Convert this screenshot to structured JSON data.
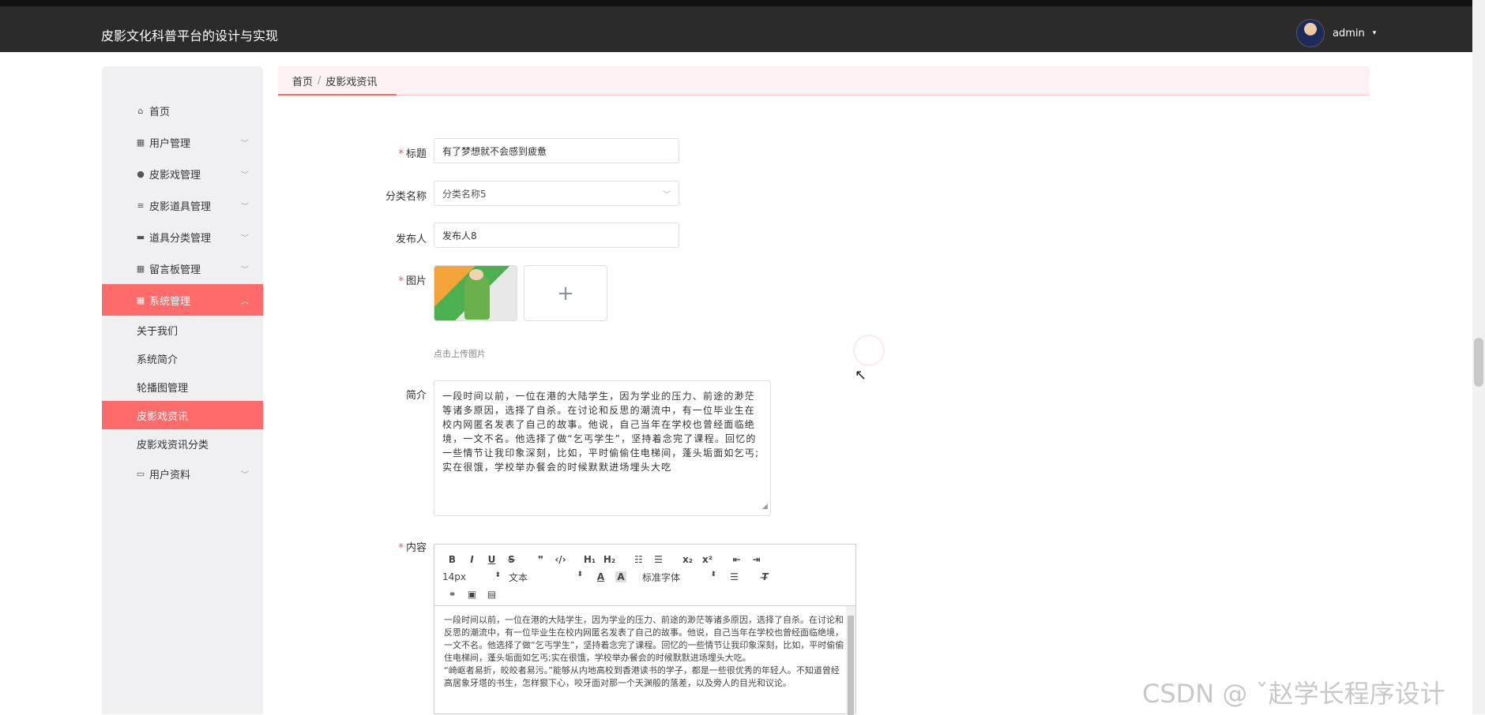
{
  "header": {
    "title": "皮影文化科普平台的设计与实现",
    "username": "admin",
    "caret": "▾"
  },
  "sidebar": {
    "items": [
      {
        "label": "首页",
        "icon": "⌂"
      },
      {
        "label": "用户管理",
        "icon": "▦"
      },
      {
        "label": "皮影戏管理",
        "icon": "●"
      },
      {
        "label": "皮影道具管理",
        "icon": "≡"
      },
      {
        "label": "道具分类管理",
        "icon": "▬"
      },
      {
        "label": "留言板管理",
        "icon": "▦"
      },
      {
        "label": "系统管理",
        "icon": "▦"
      }
    ],
    "system_sub": [
      "关于我们",
      "系统简介",
      "轮播图管理",
      "皮影戏资讯",
      "皮影戏资讯分类"
    ],
    "last_item": {
      "label": "用户资料",
      "icon": "▭"
    }
  },
  "breadcrumb": {
    "home": "首页",
    "sep": "/",
    "current": "皮影戏资讯"
  },
  "form": {
    "title_label": "标题",
    "title_value": "有了梦想就不会感到疲惫",
    "category_label": "分类名称",
    "category_value": "分类名称5",
    "publisher_label": "发布人",
    "publisher_value": "发布人8",
    "image_label": "图片",
    "upload_plus": "+",
    "upload_hint": "点击上传图片",
    "summary_label": "简介",
    "summary_value": "一段时间以前，一位在港的大陆学生，因为学业的压力、前途的渺茫等诸多原因，选择了自杀。在讨论和反思的潮流中，有一位毕业生在校内网匿名发表了自己的故事。他说，自己当年在学校也曾经面临绝境，一文不名。他选择了做“乞丐学生”，坚持着念完了课程。回忆的一些情节让我印象深刻，比如，平时偷偷住电梯间，蓬头垢面如乞丐;实在很饿，学校举办餐会的时候默默进场埋头大吃",
    "content_label": "内容",
    "required_mark": "*"
  },
  "editor": {
    "row1": [
      "B",
      "I",
      "U",
      "S",
      "❞",
      "‹/›",
      "H₁",
      "H₂",
      "☷",
      "☰",
      "x₂",
      "x²",
      "⇤",
      "⇥"
    ],
    "font_size": "14px",
    "text_type": "文本",
    "font_family": "标准字体",
    "body": "一段时间以前，一位在港的大陆学生，因为学业的压力、前途的渺茫等诸多原因，选择了自杀。在讨论和反思的潮流中，有一位毕业生在校内网匿名发表了自己的故事。他说，自己当年在学校也曾经面临绝境，一文不名。他选择了做“乞丐学生”，坚持着念完了课程。回忆的一些情节让我印象深刻，比如，平时偷偷住电梯间，蓬头垢面如乞丐;实在很饿，学校举办餐会的时候默默进场埋头大吃。",
    "body2": "“崎岖者易折，皎皎者易污。”能够从内地高校到香港读书的学子，都是一些很优秀的年轻人。不知道曾经高居象牙塔的书生，怎样狠下心，咬牙面对那一个天渊般的落差，以及旁人的目光和议论。"
  },
  "watermark": "CSDN @ ˇ赵学长程序设计"
}
